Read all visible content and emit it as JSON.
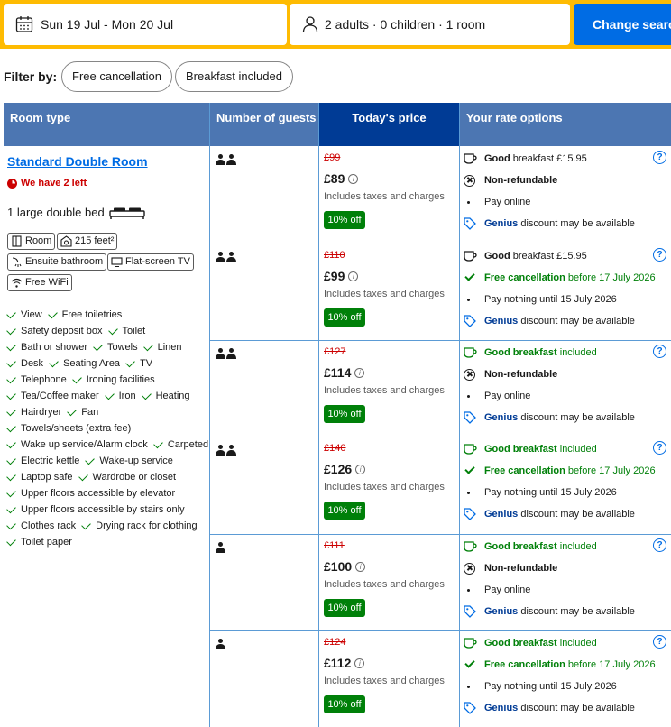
{
  "search": {
    "dates": "Sun 19 Jul - Mon 20 Jul",
    "guests": "2 adults · 0 children · 1 room",
    "button": "Change search"
  },
  "filter": {
    "label": "Filter by:",
    "chips": [
      "Free cancellation",
      "Breakfast included"
    ]
  },
  "table": {
    "headers": [
      "Room type",
      "Number of guests",
      "Today's price",
      "Your rate options"
    ]
  },
  "room": {
    "name": "Standard Double Room",
    "warning": "We have 2 left",
    "bed": "1 large double bed",
    "tags": [
      "Room",
      "215 feet²",
      "Ensuite bathroom",
      "Flat-screen TV",
      "Free WiFi"
    ],
    "facilities": [
      [
        "View",
        "Free toiletries"
      ],
      [
        "Safety deposit box",
        "Toilet"
      ],
      [
        "Bath or shower",
        "Towels",
        "Linen"
      ],
      [
        "Desk",
        "Seating Area",
        "TV"
      ],
      [
        "Telephone",
        "Ironing facilities"
      ],
      [
        "Tea/Coffee maker",
        "Iron",
        "Heating"
      ],
      [
        "Hairdryer",
        "Fan"
      ],
      [
        "Towels/sheets (extra fee)"
      ],
      [
        "Wake up service/Alarm clock",
        "Carpeted"
      ],
      [
        "Electric kettle",
        "Wake-up service"
      ],
      [
        "Laptop safe",
        "Wardrobe or closet"
      ],
      [
        "Upper floors accessible by elevator"
      ],
      [
        "Upper floors accessible by stairs only"
      ],
      [
        "Clothes rack",
        "Drying rack for clothing"
      ],
      [
        "Toilet paper"
      ]
    ]
  },
  "rates": [
    {
      "guests": 2,
      "old": "£99",
      "price": "£89",
      "incl": "Includes taxes and charges",
      "discount": "10% off",
      "breakfast": {
        "strong": "Good",
        "rest": " breakfast £15.95",
        "included": false
      },
      "cancel": {
        "strong": "Non-refundable",
        "rest": "",
        "free": false
      },
      "pay": "Pay online",
      "genius": "Genius",
      "genius_rest": " discount may be available"
    },
    {
      "guests": 2,
      "old": "£110",
      "price": "£99",
      "incl": "Includes taxes and charges",
      "discount": "10% off",
      "breakfast": {
        "strong": "Good",
        "rest": " breakfast £15.95",
        "included": false
      },
      "cancel": {
        "strong": "Free cancellation",
        "rest": " before 17 July 2026",
        "free": true
      },
      "pay": "Pay nothing until 15 July 2026",
      "genius": "Genius",
      "genius_rest": " discount may be available"
    },
    {
      "guests": 2,
      "old": "£127",
      "price": "£114",
      "incl": "Includes taxes and charges",
      "discount": "10% off",
      "breakfast": {
        "strong": "Good breakfast",
        "rest": " included",
        "included": true
      },
      "cancel": {
        "strong": "Non-refundable",
        "rest": "",
        "free": false
      },
      "pay": "Pay online",
      "genius": "Genius",
      "genius_rest": " discount may be available"
    },
    {
      "guests": 2,
      "old": "£140",
      "price": "£126",
      "incl": "Includes taxes and charges",
      "discount": "10% off",
      "breakfast": {
        "strong": "Good breakfast",
        "rest": " included",
        "included": true
      },
      "cancel": {
        "strong": "Free cancellation",
        "rest": " before 17 July 2026",
        "free": true
      },
      "pay": "Pay nothing until 15 July 2026",
      "genius": "Genius",
      "genius_rest": " discount may be available"
    },
    {
      "guests": 1,
      "old": "£111",
      "price": "£100",
      "incl": "Includes taxes and charges",
      "discount": "10% off",
      "breakfast": {
        "strong": "Good breakfast",
        "rest": " included",
        "included": true
      },
      "cancel": {
        "strong": "Non-refundable",
        "rest": "",
        "free": false
      },
      "pay": "Pay online",
      "genius": "Genius",
      "genius_rest": " discount may be available"
    },
    {
      "guests": 1,
      "old": "£124",
      "price": "£112",
      "incl": "Includes taxes and charges",
      "discount": "10% off",
      "breakfast": {
        "strong": "Good breakfast",
        "rest": " included",
        "included": true
      },
      "cancel": {
        "strong": "Free cancellation",
        "rest": " before 17 July 2026",
        "free": true
      },
      "pay": "Pay nothing until 15 July 2026",
      "genius": "Genius",
      "genius_rest": " discount may be available"
    }
  ],
  "colors": {
    "brand_yellow": "#febb02",
    "brand_blue": "#006ce4",
    "header_blue": "#4c76b2",
    "price_header": "#003b95",
    "green": "#008009",
    "red": "#cc0000"
  }
}
